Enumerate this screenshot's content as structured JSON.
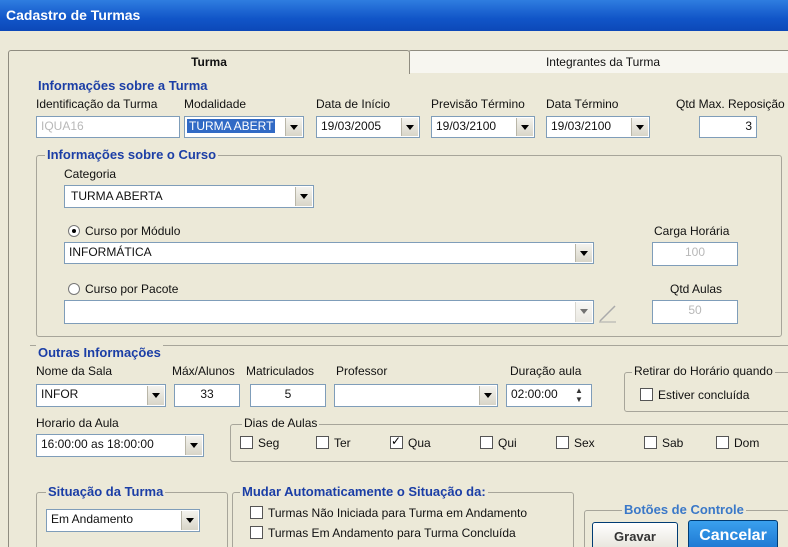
{
  "window": {
    "title": "Cadastro de Turmas"
  },
  "tabs": [
    {
      "label": "Turma"
    },
    {
      "label": "Integrantes da Turma"
    }
  ],
  "turma": {
    "group_title": "Informações sobre a Turma",
    "id_label": "Identificação da Turma",
    "id_value": "IQUA16",
    "modalidade_label": "Modalidade",
    "modalidade_value": "TURMA ABERT",
    "data_inicio_label": "Data de Início",
    "data_inicio_value": "19/03/2005",
    "previsao_label": "Previsão Término",
    "previsao_value": "19/03/2100",
    "data_termino_label": "Data Término",
    "data_termino_value": "19/03/2100",
    "qtd_max_label": "Qtd Max. Reposição",
    "qtd_max_value": "3"
  },
  "curso": {
    "group_title": "Informações sobre o Curso",
    "categoria_label": "Categoria",
    "categoria_value": "TURMA ABERTA",
    "modulo_label": "Curso por Módulo",
    "modulo_value": "INFORMÁTICA",
    "pacote_label": "Curso por Pacote",
    "pacote_value": "",
    "carga_label": "Carga Horária",
    "carga_value": "100",
    "qtd_aulas_label": "Qtd Aulas",
    "qtd_aulas_value": "50"
  },
  "outras": {
    "group_title": "Outras Informações",
    "sala_label": "Nome da Sala",
    "sala_value": "INFOR",
    "max_alunos_label": "Máx/Alunos",
    "max_alunos_value": "33",
    "matriculados_label": "Matriculados",
    "matriculados_value": "5",
    "professor_label": "Professor",
    "professor_value": "",
    "duracao_label": "Duração aula",
    "duracao_value": "02:00:00",
    "retirar_title": "Retirar do Horário quando",
    "retirar_option": "Estiver concluída",
    "horario_label": "Horario da Aula",
    "horario_value": "16:00:00 as 18:00:00",
    "dias_title": "Dias de Aulas",
    "dias": [
      {
        "label": "Seg",
        "checked": false
      },
      {
        "label": "Ter",
        "checked": false
      },
      {
        "label": "Qua",
        "checked": true
      },
      {
        "label": "Qui",
        "checked": false
      },
      {
        "label": "Sex",
        "checked": false
      },
      {
        "label": "Sab",
        "checked": false
      },
      {
        "label": "Dom",
        "checked": false
      }
    ]
  },
  "situacao": {
    "group_title": "Situação da Turma",
    "value": "Em Andamento"
  },
  "mudar": {
    "group_title": "Mudar Automaticamente o Situação da:",
    "opt1": "Turmas Não Iniciada para Turma em Andamento",
    "opt2": "Turmas Em Andamento para Turma Concluída"
  },
  "controle": {
    "group_title": "Botões de Controle",
    "gravar": "Gravar",
    "cancelar": "Cancelar"
  },
  "colors": {
    "title_bar": "#1155c8",
    "group_title": "#1b3ea6",
    "selection": "#316ac5"
  }
}
